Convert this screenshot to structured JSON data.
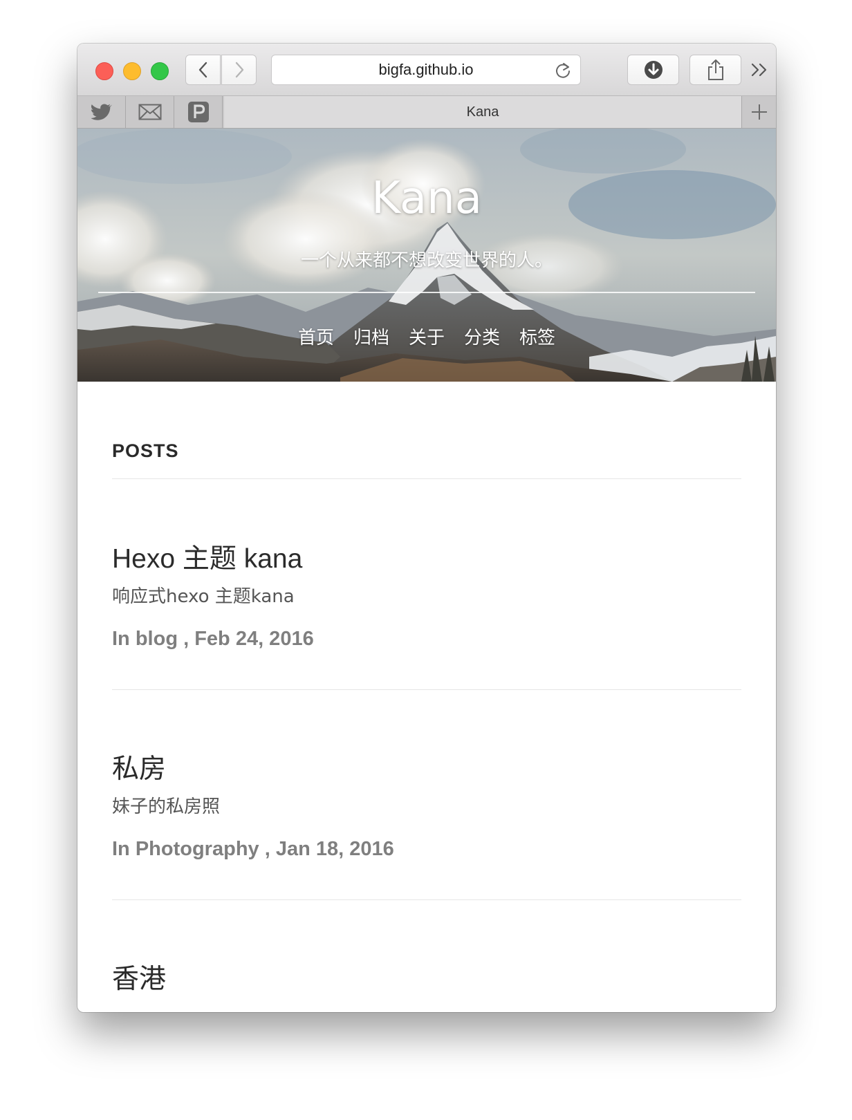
{
  "browser": {
    "url": "bigfa.github.io",
    "tab_title": "Kana",
    "favorites": [
      "twitter-icon",
      "mail-icon",
      "pinboard-icon"
    ]
  },
  "hero": {
    "title": "Kana",
    "subtitle": "一个从来都不想改变世界的人。",
    "nav": [
      "首页",
      "归档",
      "关于",
      "分类",
      "标签"
    ]
  },
  "main": {
    "section_heading": "POSTS",
    "posts": [
      {
        "title": "Hexo 主题 kana",
        "excerpt": "响应式hexo 主题kana",
        "meta": "In blog , Feb 24, 2016"
      },
      {
        "title": "私房",
        "excerpt": "妹子的私房照",
        "meta": "In Photography , Jan 18, 2016"
      },
      {
        "title": "香港"
      }
    ]
  },
  "colors": {
    "traffic_red": "#fc5f57",
    "traffic_yellow": "#fdbc2e",
    "traffic_green": "#33c748",
    "text_dark": "#2b2b2b",
    "meta_gray": "#7f7f7f"
  }
}
